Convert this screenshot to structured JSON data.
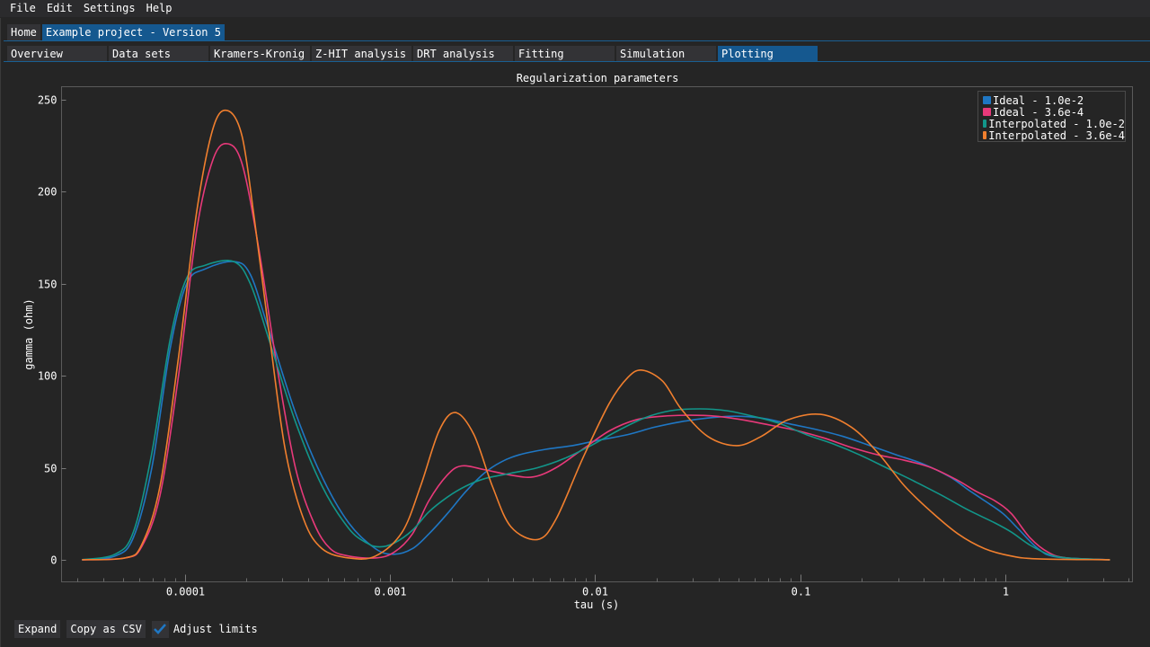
{
  "menu": [
    "File",
    "Edit",
    "Settings",
    "Help"
  ],
  "top_tabs": [
    {
      "label": "Home",
      "active": false
    },
    {
      "label": "Example project - Version 5",
      "active": true
    }
  ],
  "sub_tabs": [
    {
      "label": "Overview",
      "active": false
    },
    {
      "label": "Data sets",
      "active": false
    },
    {
      "label": "Kramers-Kronig",
      "active": false
    },
    {
      "label": "Z-HIT analysis",
      "active": false
    },
    {
      "label": "DRT analysis",
      "active": false
    },
    {
      "label": "Fitting",
      "active": false
    },
    {
      "label": "Simulation",
      "active": false
    },
    {
      "label": "Plotting",
      "active": true
    }
  ],
  "bottom": {
    "expand_label": "Expand",
    "copy_csv_label": "Copy as CSV",
    "adjust_limits_label": "Adjust limits",
    "adjust_limits_checked": true
  },
  "colors": {
    "accent": "#15588f",
    "check": "#1f77c4"
  },
  "chart_data": {
    "type": "line",
    "title": "Regularization parameters",
    "xlabel": "tau (s)",
    "ylabel": "gamma (ohm)",
    "xscale": "log",
    "xlim_log10": [
      -4.6,
      0.62
    ],
    "ylim": [
      -12,
      257
    ],
    "x_ticks": [
      {
        "value": 0.0001,
        "label": "0.0001"
      },
      {
        "value": 0.001,
        "label": "0.001"
      },
      {
        "value": 0.01,
        "label": "0.01"
      },
      {
        "value": 0.1,
        "label": "0.1"
      },
      {
        "value": 1,
        "label": "1"
      }
    ],
    "y_ticks": [
      0,
      50,
      100,
      150,
      200,
      250
    ],
    "legend_position": "top-right",
    "grid": false,
    "series": [
      {
        "name": "Ideal - 1.0e-2",
        "color": "#1f77c4",
        "log10_tau": [
          -4.5,
          -4.34,
          -4.25,
          -4.16,
          -4.07,
          -3.99,
          -3.9,
          -3.76,
          -3.68,
          -3.59,
          -3.46,
          -3.33,
          -3.2,
          -3.07,
          -2.98,
          -2.89,
          -2.81,
          -2.72,
          -2.63,
          -2.54,
          -2.46,
          -2.37,
          -2.24,
          -2.11,
          -1.98,
          -1.84,
          -1.71,
          -1.58,
          -1.45,
          -1.32,
          -1.19,
          -1.06,
          -0.93,
          -0.79,
          -0.66,
          -0.53,
          -0.4,
          -0.27,
          -0.18,
          -0.1,
          -0.01,
          0.07,
          0.16,
          0.25,
          0.51
        ],
        "gamma": [
          0,
          2,
          12,
          50,
          115,
          150,
          158,
          162,
          155,
          125,
          80,
          45,
          20,
          6,
          3,
          6,
          14,
          25,
          37,
          47,
          53,
          57,
          60,
          62,
          65,
          68,
          72,
          75,
          77,
          78,
          77,
          74,
          71,
          67,
          62,
          57,
          52,
          45,
          38,
          32,
          25,
          16,
          6,
          1.5,
          0
        ]
      },
      {
        "name": "Ideal - 3.6e-4",
        "color": "#e8397a",
        "log10_tau": [
          -4.5,
          -4.29,
          -4.21,
          -4.12,
          -4.03,
          -3.94,
          -3.86,
          -3.79,
          -3.72,
          -3.64,
          -3.55,
          -3.46,
          -3.37,
          -3.29,
          -3.2,
          -3.07,
          -2.98,
          -2.89,
          -2.81,
          -2.72,
          -2.65,
          -2.54,
          -2.41,
          -2.3,
          -2.19,
          -2.06,
          -1.93,
          -1.8,
          -1.67,
          -1.54,
          -1.41,
          -1.28,
          -1.14,
          -1.01,
          -0.88,
          -0.75,
          -0.62,
          -0.49,
          -0.36,
          -0.23,
          -0.14,
          -0.05,
          0.03,
          0.12,
          0.21,
          0.3,
          0.51
        ],
        "gamma": [
          0,
          1,
          7,
          35,
          100,
          180,
          218,
          226,
          215,
          170,
          105,
          50,
          20,
          6,
          2,
          1,
          4,
          14,
          32,
          46,
          51,
          49,
          46,
          45,
          50,
          60,
          70,
          76,
          78,
          78.5,
          78,
          76,
          73,
          70,
          66,
          61,
          57,
          54,
          50,
          43,
          37,
          32,
          25,
          12,
          4,
          1,
          0
        ]
      },
      {
        "name": "Interpolated - 1.0e-2",
        "color": "#12968a",
        "log10_tau": [
          -4.5,
          -4.34,
          -4.25,
          -4.16,
          -4.07,
          -3.99,
          -3.9,
          -3.76,
          -3.68,
          -3.59,
          -3.46,
          -3.33,
          -3.2,
          -3.11,
          -3.05,
          -2.98,
          -2.89,
          -2.81,
          -2.72,
          -2.63,
          -2.54,
          -2.41,
          -2.28,
          -2.15,
          -2.02,
          -1.89,
          -1.76,
          -1.63,
          -1.49,
          -1.36,
          -1.23,
          -1.1,
          -0.97,
          -0.84,
          -0.71,
          -0.58,
          -0.45,
          -0.31,
          -0.18,
          -0.05,
          0.03,
          0.12,
          0.21,
          0.3,
          0.51
        ],
        "gamma": [
          0,
          3,
          15,
          58,
          120,
          153,
          160,
          162,
          150,
          120,
          75,
          40,
          17,
          9,
          7,
          9,
          16,
          26,
          34,
          40,
          44,
          47,
          50,
          55,
          62,
          70,
          77,
          81,
          82,
          81,
          78,
          74,
          68,
          63,
          57,
          50,
          43,
          35,
          27,
          20,
          15,
          8,
          3,
          1,
          0
        ]
      },
      {
        "name": "Interpolated - 3.6e-4",
        "color": "#f07f2e",
        "log10_tau": [
          -4.5,
          -4.29,
          -4.21,
          -4.12,
          -4.03,
          -3.94,
          -3.86,
          -3.79,
          -3.72,
          -3.66,
          -3.59,
          -3.51,
          -3.42,
          -3.33,
          -3.2,
          -3.07,
          -2.94,
          -2.85,
          -2.76,
          -2.68,
          -2.59,
          -2.5,
          -2.41,
          -2.28,
          -2.19,
          -2.06,
          -1.93,
          -1.84,
          -1.77,
          -1.67,
          -1.58,
          -1.45,
          -1.31,
          -1.19,
          -1.06,
          -0.9,
          -0.75,
          -0.62,
          -0.49,
          -0.36,
          -0.23,
          -0.1,
          0.03,
          0.16,
          0.51
        ],
        "gamma": [
          0,
          1,
          8,
          40,
          110,
          190,
          235,
          244,
          230,
          185,
          125,
          60,
          22,
          6,
          1,
          2,
          15,
          40,
          70,
          80,
          68,
          40,
          18,
          11,
          22,
          55,
          85,
          99,
          103,
          97,
          82,
          67,
          62,
          67,
          76,
          79,
          72,
          58,
          40,
          26,
          14,
          6,
          2,
          0.5,
          0
        ]
      }
    ]
  }
}
